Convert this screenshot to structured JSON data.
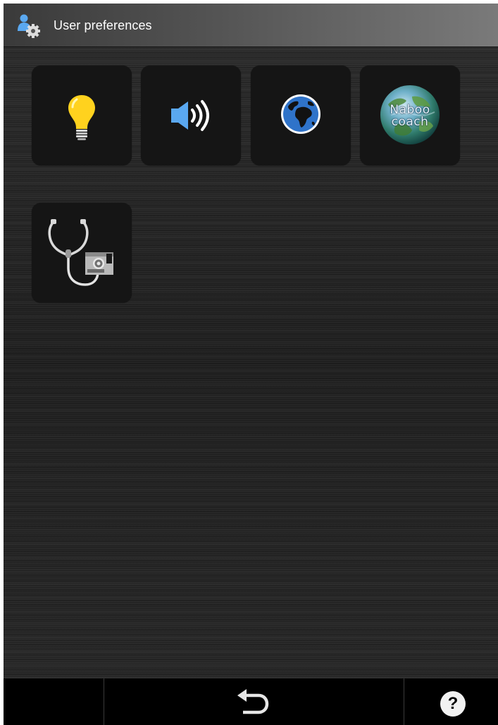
{
  "header": {
    "title": "User preferences",
    "icon": "user-settings-icon"
  },
  "tiles": [
    {
      "name": "brightness",
      "icon": "lightbulb-icon"
    },
    {
      "name": "sound",
      "icon": "speaker-volume-icon"
    },
    {
      "name": "language",
      "icon": "globe-icon"
    },
    {
      "name": "naboo-coach",
      "icon": "naboo-coach-globe-icon",
      "line1": "Naboo",
      "line2": "coach"
    },
    {
      "name": "diagnostics",
      "icon": "stethoscope-device-icon"
    }
  ],
  "bottombar": {
    "back_icon": "back-arrow-icon",
    "help_label": "?",
    "help_icon": "help-icon"
  },
  "colors": {
    "bulb_yellow": "#ffd21e",
    "speaker_blue": "#5aa8f0",
    "globe_blue": "#2f73c9",
    "header_gradient_end": "#7a7a7a"
  }
}
